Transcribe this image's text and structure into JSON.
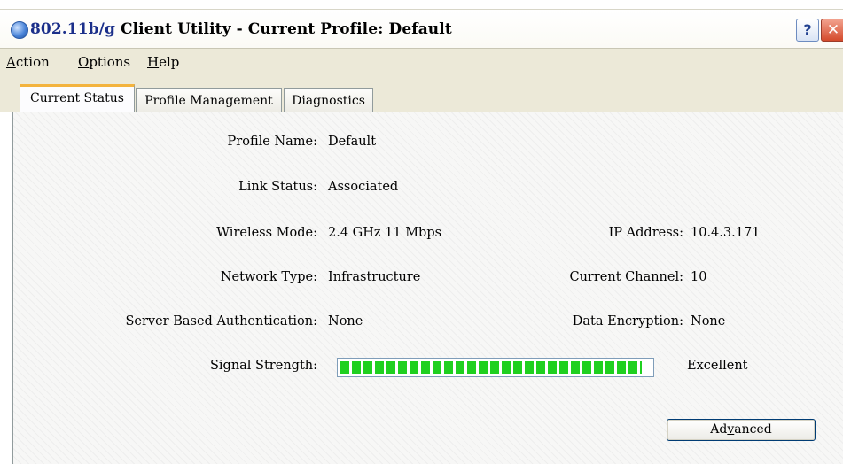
{
  "window": {
    "title_prefix": "802.11b/g",
    "title_suffix": "Client Utility - Current Profile: Default",
    "help_label": "?",
    "close_label": "✕"
  },
  "menu": {
    "items": [
      {
        "access_key": "A",
        "rest": "ction"
      },
      {
        "access_key": "O",
        "rest": "ptions"
      },
      {
        "access_key": "H",
        "rest": "elp"
      }
    ]
  },
  "tabs": [
    {
      "label": "Current Status",
      "active": true
    },
    {
      "label": "Profile Management",
      "active": false
    },
    {
      "label": "Diagnostics",
      "active": false
    }
  ],
  "status": {
    "profile_name_label": "Profile Name:",
    "profile_name": "Default",
    "link_status_label": "Link Status:",
    "link_status": "Associated",
    "wireless_mode_label": "Wireless Mode:",
    "wireless_mode": "2.4 GHz 11 Mbps",
    "ip_address_label": "IP Address:",
    "ip_address": "10.4.3.171",
    "network_type_label": "Network Type:",
    "network_type": "Infrastructure",
    "current_channel_label": "Current Channel:",
    "current_channel": "10",
    "server_auth_label": "Server Based Authentication:",
    "server_auth": "None",
    "data_encryption_label": "Data Encryption:",
    "data_encryption": "None",
    "signal_strength_label": "Signal Strength:",
    "signal_strength_text": "Excellent",
    "signal_strength_fraction": 0.97
  },
  "buttons": {
    "advanced_pre": "Ad",
    "advanced_key": "v",
    "advanced_post": "anced"
  },
  "colors": {
    "signal_green": "#1fd01f",
    "active_tab_accent": "#f3b33e",
    "menubar_bg": "#ece9d8"
  }
}
